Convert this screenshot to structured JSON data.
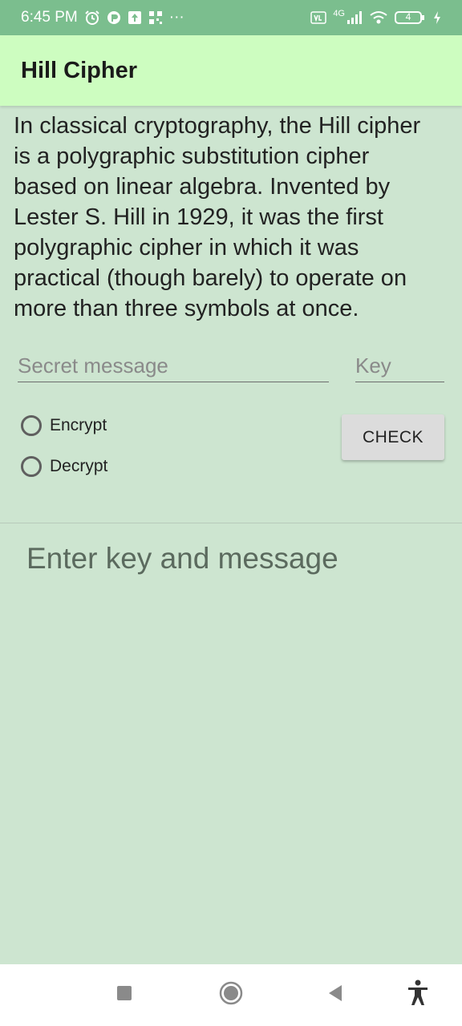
{
  "status_bar": {
    "time": "6:45 PM",
    "more": "···",
    "network": "4G",
    "battery": "4"
  },
  "app_bar": {
    "title": "Hill Cipher"
  },
  "description": "In classical cryptography, the Hill cipher\nis a polygraphic substitution cipher\nbased on linear algebra. Invented by\nLester S. Hill in 1929, it was the first\npolygraphic cipher in which it was\npractical (though barely) to operate on\nmore than three symbols at once.",
  "inputs": {
    "message": {
      "placeholder": "Secret message",
      "value": ""
    },
    "key": {
      "placeholder": "Key",
      "value": ""
    }
  },
  "modes": [
    {
      "label": "Encrypt",
      "selected": false
    },
    {
      "label": "Decrypt",
      "selected": false
    }
  ],
  "check_button": {
    "label": "CHECK"
  },
  "result_text": "Enter key and message",
  "nav_icons": [
    "recents-icon",
    "home-icon",
    "back-icon",
    "accessibility-icon"
  ]
}
